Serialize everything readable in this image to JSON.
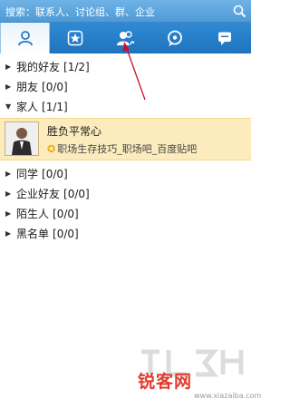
{
  "search": {
    "placeholder": "搜索：联系人、讨论组、群、企业"
  },
  "tabs": [
    {
      "icon": "contacts-icon",
      "active": true
    },
    {
      "icon": "favorite-star-icon",
      "active": false
    },
    {
      "icon": "groups-icon",
      "active": false
    },
    {
      "icon": "discussion-icon",
      "active": false
    },
    {
      "icon": "recent-chat-icon",
      "active": false
    }
  ],
  "groups_before": [
    {
      "label": "我的好友",
      "count": "[1/2]",
      "expanded": false
    },
    {
      "label": "朋友",
      "count": "[0/0]",
      "expanded": false
    },
    {
      "label": "家人",
      "count": "[1/1]",
      "expanded": true
    }
  ],
  "contact": {
    "name": "胜负平常心",
    "status": "职场生存技巧_职场吧_百度贴吧"
  },
  "groups_after": [
    {
      "label": "同学",
      "count": "[0/0]"
    },
    {
      "label": "企业好友",
      "count": "[0/0]"
    },
    {
      "label": "陌生人",
      "count": "[0/0]"
    },
    {
      "label": "黑名单",
      "count": "[0/0]"
    }
  ],
  "watermark": {
    "logo": "锐客网",
    "url": "www.xiazaiba.com"
  },
  "colors": {
    "header_blue": "#2f8ad4",
    "highlight": "#fcecbd",
    "annotation": "#c8102e"
  }
}
